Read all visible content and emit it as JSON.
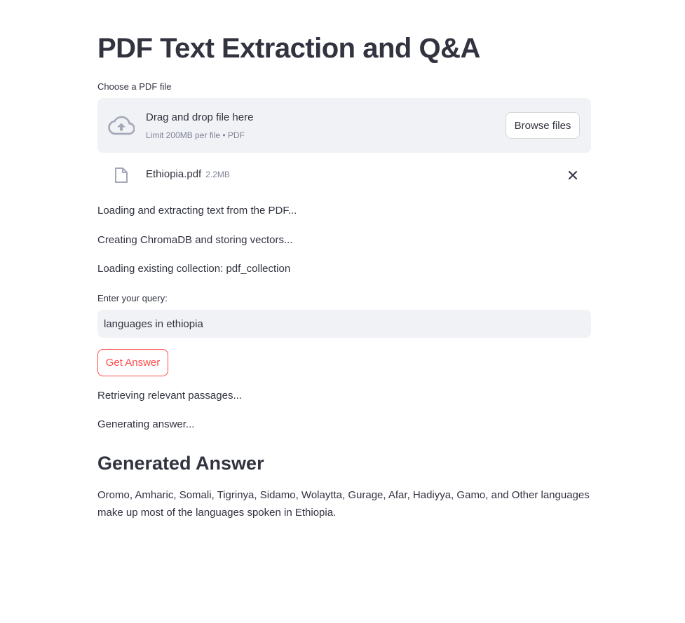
{
  "title": "PDF Text Extraction and Q&A",
  "uploader": {
    "label": "Choose a PDF file",
    "drop_text": "Drag and drop file here",
    "limit_text": "Limit 200MB per file • PDF",
    "browse_label": "Browse files",
    "icon": "cloud-upload-icon"
  },
  "uploaded_file": {
    "name": "Ethiopia.pdf",
    "size": "2.2MB",
    "icon": "file-icon",
    "remove_icon": "close-icon"
  },
  "status_messages": [
    "Loading and extracting text from the PDF...",
    "Creating ChromaDB and storing vectors...",
    "Loading existing collection: pdf_collection"
  ],
  "query": {
    "label": "Enter your query:",
    "value": "languages in ethiopia"
  },
  "get_answer_label": "Get Answer",
  "progress_messages": [
    "Retrieving relevant passages...",
    "Generating answer..."
  ],
  "answer": {
    "heading": "Generated Answer",
    "text": "Oromo, Amharic, Somali, Tigrinya, Sidamo, Wolaytta, Gurage, Afar, Hadiyya, Gamo, and Other languages make up most of the languages spoken in Ethiopia."
  },
  "colors": {
    "text": "#31333f",
    "muted": "#808495",
    "accent": "#ff4b4b",
    "input_bg": "#f0f2f6"
  }
}
